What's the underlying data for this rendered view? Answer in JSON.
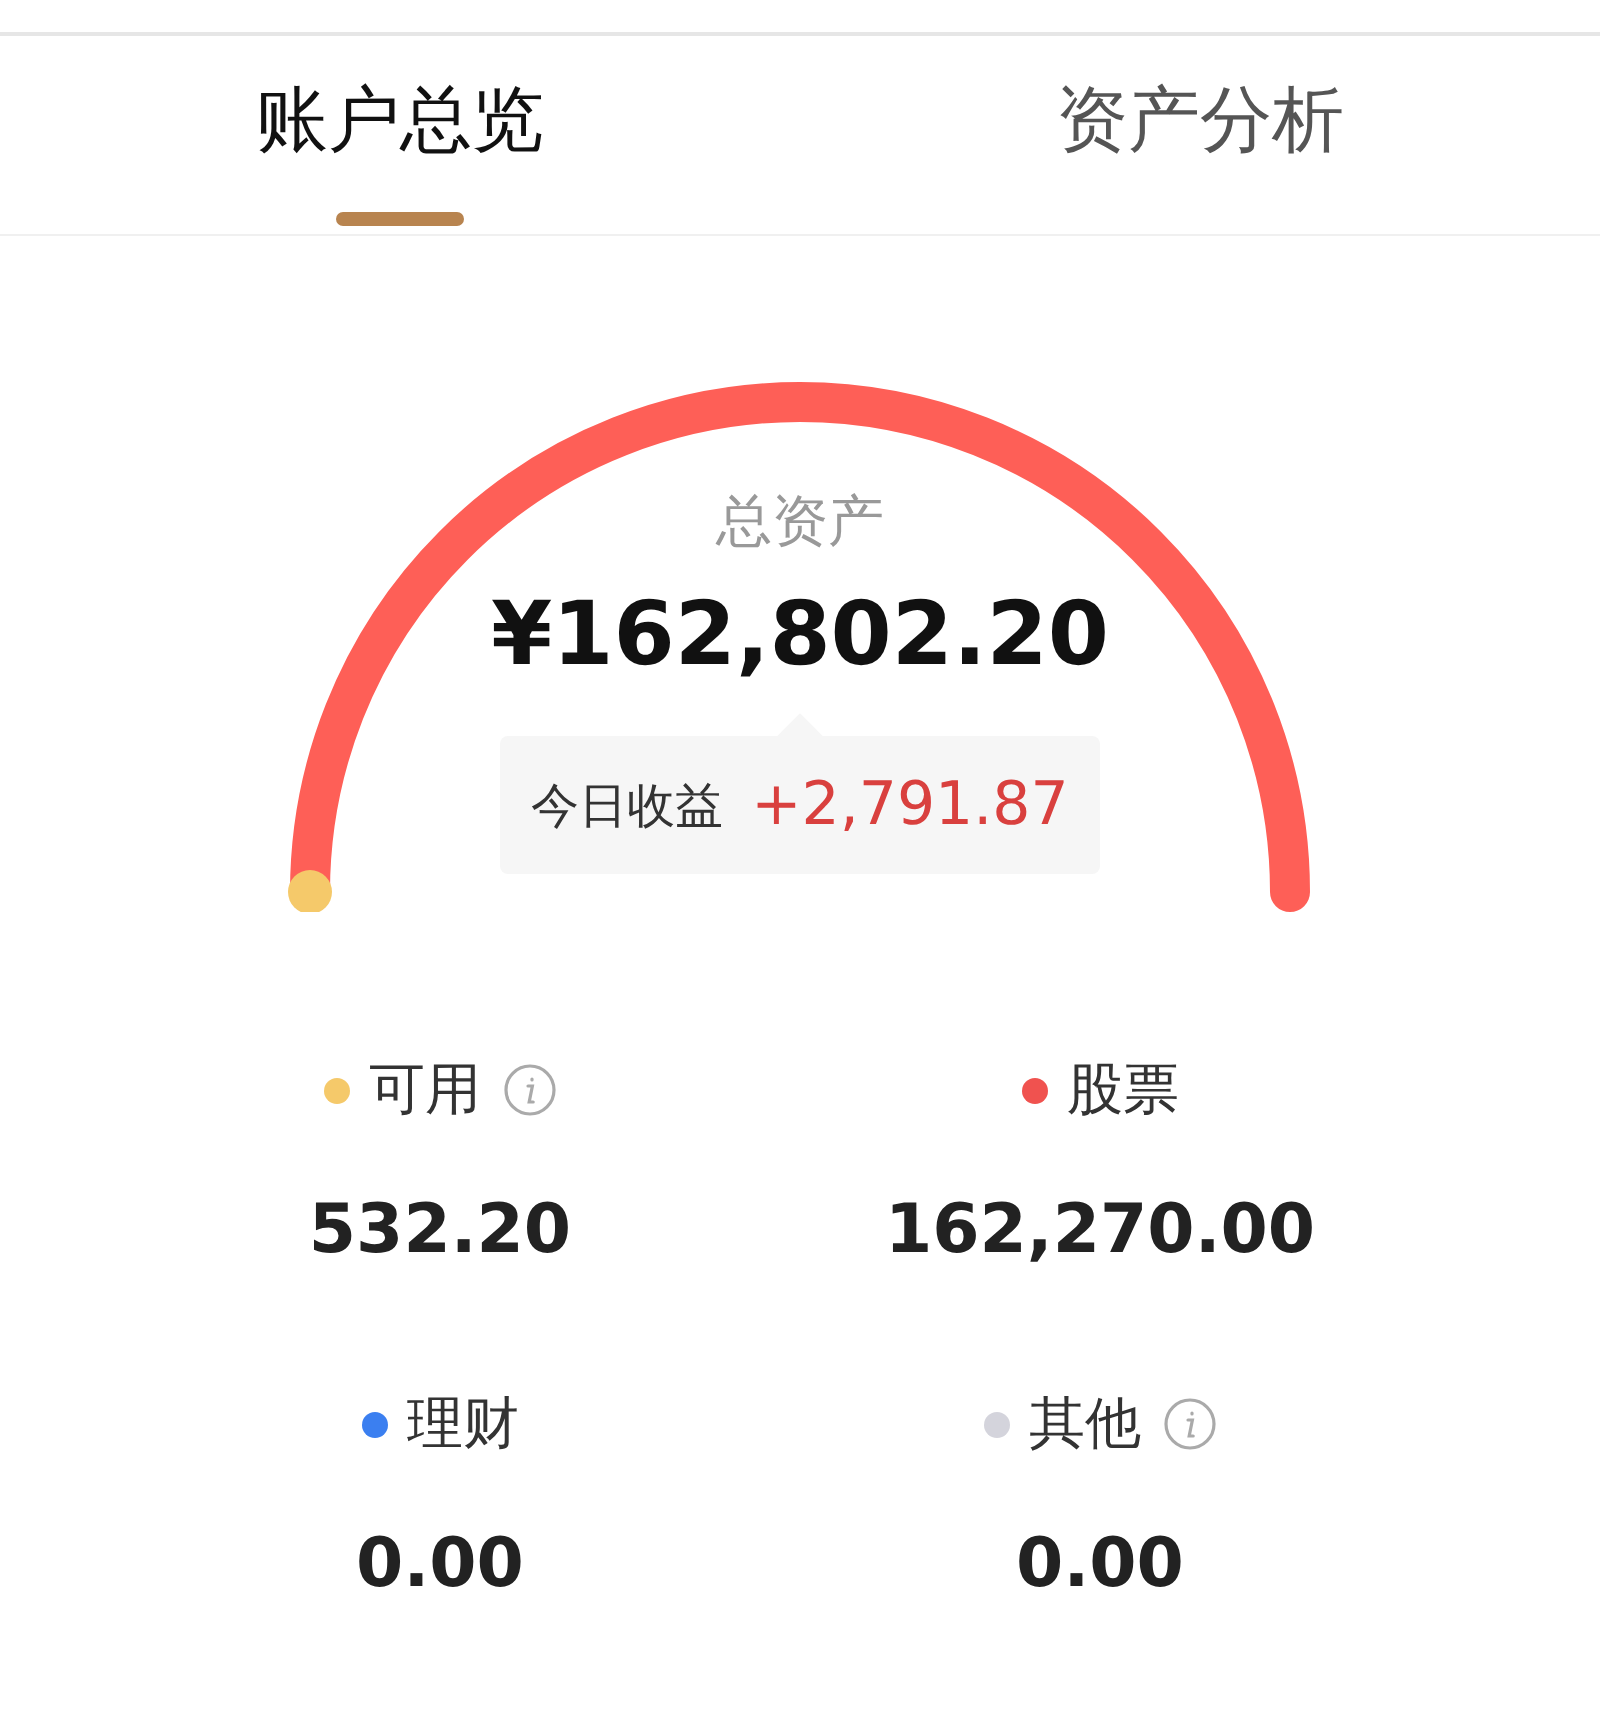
{
  "tabs": [
    {
      "label": "账户总览",
      "selected": true
    },
    {
      "label": "资产分析",
      "selected": false
    }
  ],
  "summary": {
    "title": "总资产",
    "amount": "¥162,802.20",
    "today_label": "今日收益",
    "today_value": "+2,791.87"
  },
  "assets": [
    {
      "label": "可用",
      "color": "#f5c96a",
      "info": true,
      "value": "532.20"
    },
    {
      "label": "股票",
      "color": "#f0524f",
      "info": false,
      "value": "162,270.00"
    },
    {
      "label": "理财",
      "color": "#3b7ff0",
      "info": false,
      "value": "0.00"
    },
    {
      "label": "其他",
      "color": "#d4d4dc",
      "info": true,
      "value": "0.00"
    }
  ]
}
